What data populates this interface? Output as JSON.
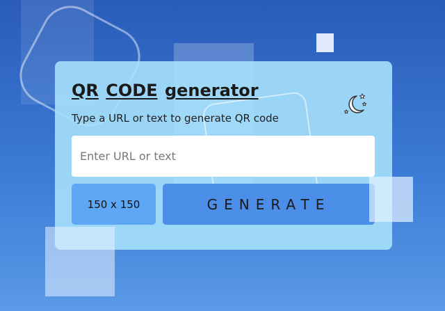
{
  "app": {
    "title_words": [
      "QR",
      "CODE",
      "generator"
    ],
    "subtitle": "Type a URL or text to generate QR code"
  },
  "input": {
    "placeholder": "Enter URL or text",
    "value": ""
  },
  "size_select": {
    "selected": "150 x 150"
  },
  "generate_button": {
    "label": "GENERATE"
  },
  "theme_toggle": {
    "icon": "moon-stars-icon"
  },
  "colors": {
    "background_top": "#2a5cb9",
    "background_bottom": "#5a9ae6",
    "card": "#a9e2fc",
    "size_select": "#5ea7f5",
    "generate_button": "#4b8ee8"
  }
}
